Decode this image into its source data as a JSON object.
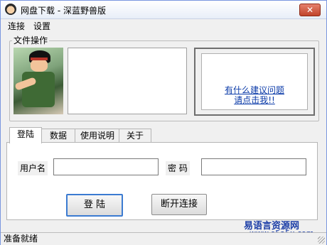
{
  "window": {
    "title": "网盘下载 - 深蓝野兽版",
    "close_icon": "close-icon"
  },
  "menu": {
    "items": [
      "连接",
      "设置"
    ]
  },
  "file_group": {
    "label": "文件操作"
  },
  "suggestion": {
    "line1": "有什么建议问题",
    "line2": "请点击我!!"
  },
  "tabs": [
    "登陆",
    "数据",
    "使用说明",
    "关于"
  ],
  "login": {
    "username_label": "用户名",
    "password_label": "密  码",
    "username_value": "",
    "password_value": "",
    "login_button": "登  陆",
    "disconnect_button": "断开连接"
  },
  "watermark": {
    "text": "易语言资源网",
    "url": "www.e5a5x.com"
  },
  "status": {
    "text": "准备就绪"
  }
}
